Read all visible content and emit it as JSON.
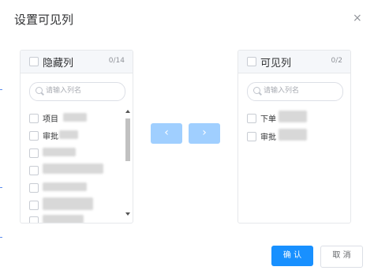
{
  "dialog": {
    "title": "设置可见列",
    "close_glyph": "×"
  },
  "hidden_panel": {
    "title": "隐藏列",
    "count": "0/14",
    "search_placeholder": "请输入列名",
    "items": [
      "项目",
      "审批"
    ]
  },
  "visible_panel": {
    "title": "可见列",
    "count": "0/2",
    "search_placeholder": "请输入列名",
    "items": [
      "下单",
      "审批"
    ]
  },
  "transfer": {
    "to_left_glyph": "‹",
    "to_right_glyph": "›"
  },
  "footer": {
    "confirm_label": "确 认",
    "cancel_label": "取 消"
  },
  "colors": {
    "primary": "#1890ff",
    "arrow_disabled": "#a0cfff",
    "panel_header": "#f5f7fa"
  }
}
